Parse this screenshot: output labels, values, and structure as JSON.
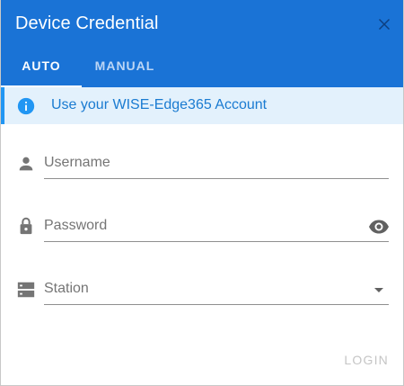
{
  "dialog": {
    "title": "Device Credential",
    "close_icon": "close-icon"
  },
  "tabs": [
    {
      "label": "AUTO",
      "active": true
    },
    {
      "label": "MANUAL",
      "active": false
    }
  ],
  "info": {
    "icon": "info-icon",
    "text": "Use your WISE-Edge365 Account"
  },
  "form": {
    "username": {
      "icon": "person-icon",
      "placeholder": "Username",
      "value": ""
    },
    "password": {
      "icon": "lock-icon",
      "placeholder": "Password",
      "value": "",
      "toggle_icon": "eye-icon"
    },
    "station": {
      "icon": "storage-icon",
      "placeholder": "Station",
      "value": "",
      "dropdown_icon": "caret-down-icon"
    }
  },
  "actions": {
    "login_label": "LOGIN",
    "login_disabled": true
  },
  "colors": {
    "header": "#1a73d6",
    "info_background": "#e3f1fc",
    "info_text": "#1a7bd1",
    "disabled_text": "#c5c5c5"
  }
}
